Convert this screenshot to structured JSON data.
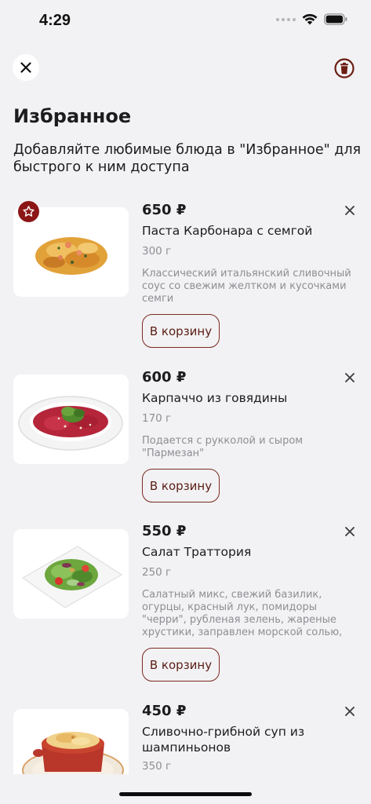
{
  "status_bar": {
    "time": "4:29"
  },
  "header": {
    "close_icon": "close-icon",
    "trash_icon": "trash-icon",
    "title": "Избранное",
    "subtitle": "Добавляйте любимые блюда в \"Избранное\" для быстрого к ним доступа"
  },
  "colors": {
    "accent": "#8c1616",
    "button_border": "#7a2a1e",
    "button_text": "#5a1d13",
    "muted": "#8e8e93",
    "background": "#f2f2f4"
  },
  "items": [
    {
      "price": "650 ₽",
      "name": "Паста Карбонара с семгой",
      "weight": "300 г",
      "description": "Классический итальянский сливочный соус со свежим желтком и кусочками семги",
      "cart_label": "В корзину",
      "favorite_icon": "star-icon"
    },
    {
      "price": "600 ₽",
      "name": "Карпаччо из говядины",
      "weight": "170 г",
      "description": "Подается с рукколой и сыром \"Пармезан\"",
      "cart_label": "В корзину"
    },
    {
      "price": "550 ₽",
      "name": "Салат Траттория",
      "weight": "250 г",
      "description": "Салатный микс, свежий базилик, огурцы, красный лук, помидоры \"черри\", рубленая зелень, жареные хрустики, заправлен морской солью, оливковым…",
      "cart_label": "В корзину"
    },
    {
      "price": "450 ₽",
      "name": "Сливочно-грибной суп из шампиньонов",
      "weight": "350 г"
    }
  ]
}
